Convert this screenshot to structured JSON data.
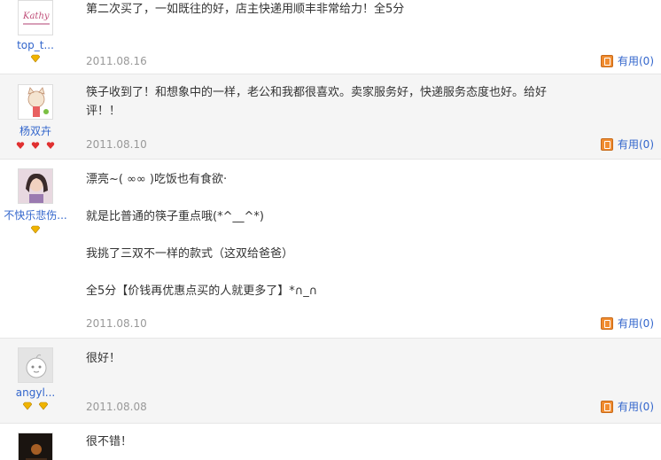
{
  "reviews": [
    {
      "user": "top_t...",
      "lines": [
        "第二次买了，一如既往的好，店主快递用顺丰非常给力！全5分"
      ],
      "date": "2011.08.16",
      "useful": "有用(0)",
      "badge_type": "diamond",
      "badge_count": 1,
      "avatar": "avatar-logo"
    },
    {
      "user": "杨双卉",
      "lines": [
        "筷子收到了！和想象中的一样，老公和我都很喜欢。卖家服务好，快递服务态度也好。给好",
        "评！！"
      ],
      "date": "2011.08.10",
      "useful": "有用(0)",
      "badge_type": "heart",
      "badge_count": 3,
      "avatar": "avatar-cat"
    },
    {
      "user": "不快乐悲伤...",
      "lines": [
        "漂亮~( ∞∞ )吃饭也有食欲·",
        "",
        "就是比普通的筷子重点哦(*^__^*)",
        "",
        "我挑了三双不一样的款式（这双给爸爸）",
        "",
        "全5分【价钱再优惠点买的人就更多了】*∩_∩"
      ],
      "date": "2011.08.10",
      "useful": "有用(0)",
      "badge_type": "diamond",
      "badge_count": 1,
      "avatar": "avatar-photo"
    },
    {
      "user": "angyl...",
      "lines": [
        "很好！"
      ],
      "date": "2011.08.08",
      "useful": "有用(0)",
      "badge_type": "diamond",
      "badge_count": 2,
      "avatar": "avatar-default"
    },
    {
      "user": "",
      "lines": [
        "很不错！"
      ],
      "date": "",
      "useful": "",
      "badge_type": "none",
      "badge_count": 0,
      "avatar": "avatar-dark"
    }
  ],
  "colors": {
    "link": "#3366cc",
    "date": "#999999",
    "alt_row": "#f5f5f5",
    "useful_icon": "#f08c30",
    "diamond": "#f0b400",
    "heart": "#e03030"
  }
}
